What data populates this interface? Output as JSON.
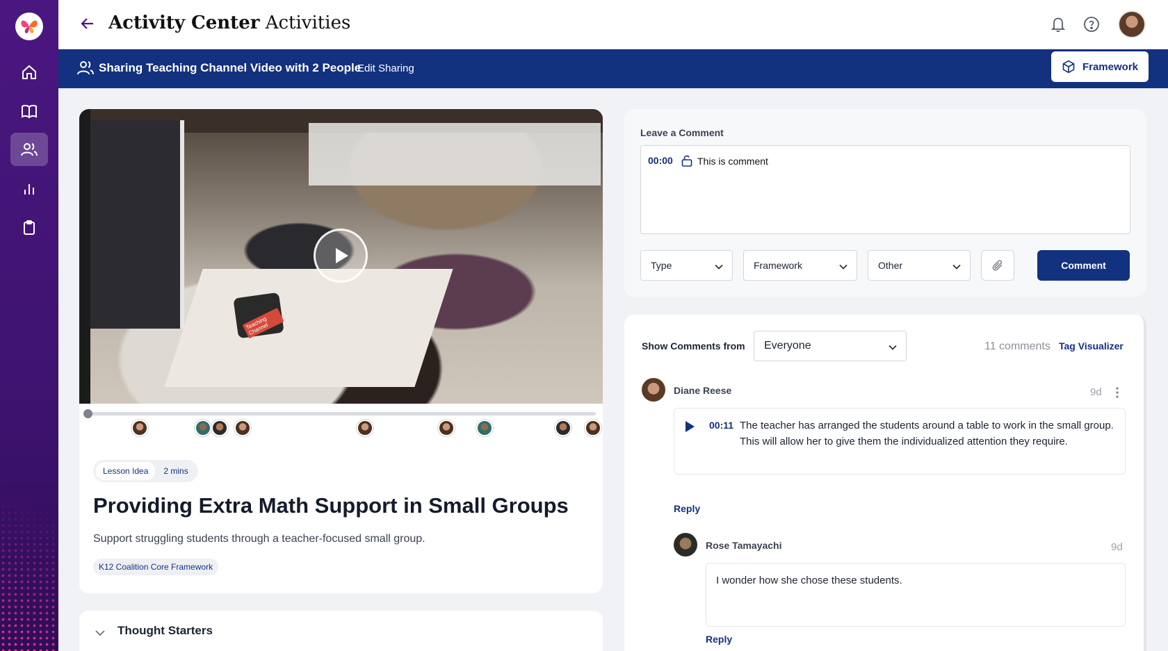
{
  "app": {
    "title_bold": "Activity Center",
    "title_rest": "Activities"
  },
  "share_bar": {
    "text": "Sharing Teaching Channel Video with 2 People",
    "edit_label": "Edit Sharing",
    "framework_button": "Framework"
  },
  "video": {
    "watermark": "Teaching Channel"
  },
  "lesson": {
    "type_label": "Lesson Idea",
    "duration": "2 mins",
    "title": "Providing Extra Math Support in Small Groups",
    "description": "Support struggling students through a teacher-focused small group.",
    "framework_tag": "K12 Coalition Core Framework"
  },
  "thought_starters": {
    "label": "Thought Starters"
  },
  "comment_form": {
    "label": "Leave a Comment",
    "timestamp": "00:00",
    "text": "This is comment",
    "type_select": "Type",
    "framework_select": "Framework",
    "other_select": "Other",
    "submit_label": "Comment"
  },
  "comments_panel": {
    "show_label": "Show Comments from",
    "filter_value": "Everyone",
    "count_text": "11 comments",
    "tag_visualizer": "Tag Visualizer"
  },
  "comments": [
    {
      "author": "Diane Reese",
      "age": "9d",
      "timestamp": "00:11",
      "text": "The teacher has arranged the students around a table to work in the small group. This will allow her to give them the individualized attention they require.",
      "reply_label": "Reply"
    },
    {
      "author": "Rose Tamayachi",
      "age": "9d",
      "text": "I wonder how she chose these students.",
      "reply_label": "Reply"
    }
  ],
  "colors": {
    "brand_navy": "#12317f",
    "rail_purple": "#4a1780",
    "accent_pink": "#ff3c96"
  }
}
